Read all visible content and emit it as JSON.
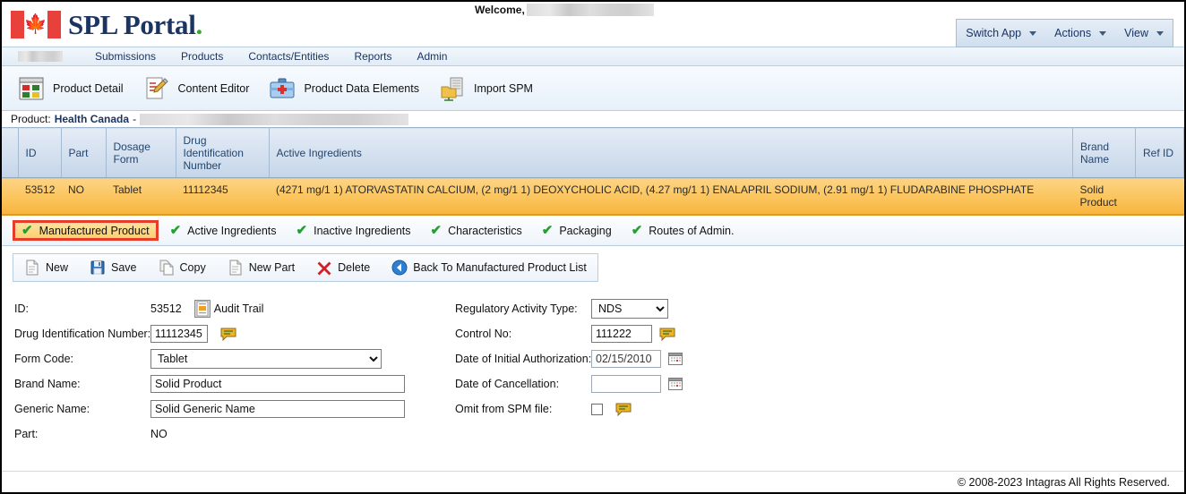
{
  "header": {
    "brand_name": "SPL Portal",
    "brand_dot": ".",
    "welcome_label": "Welcome,",
    "flag_icon": "canada-flag-icon"
  },
  "appbar": {
    "items": [
      {
        "label": "Switch App",
        "icon": "chevron-down-icon"
      },
      {
        "label": "Actions",
        "icon": "chevron-down-icon"
      },
      {
        "label": "View",
        "icon": "chevron-down-icon"
      }
    ]
  },
  "menu": {
    "items": [
      {
        "label": "Submissions"
      },
      {
        "label": "Products"
      },
      {
        "label": "Contacts/Entities"
      },
      {
        "label": "Reports"
      },
      {
        "label": "Admin"
      }
    ]
  },
  "icon_toolbar": {
    "items": [
      {
        "label": "Product Detail",
        "icon": "grid-window-icon"
      },
      {
        "label": "Content Editor",
        "icon": "pencil-document-icon"
      },
      {
        "label": "Product Data Elements",
        "icon": "medical-kit-icon"
      },
      {
        "label": "Import SPM",
        "icon": "server-folder-icon"
      }
    ]
  },
  "product_line": {
    "label": "Product:",
    "organization": "Health Canada",
    "separator": "-"
  },
  "grid": {
    "columns": [
      "ID",
      "Part",
      "Dosage Form",
      "Drug Identification Number",
      "Active Ingredients",
      "Brand Name",
      "Ref ID"
    ],
    "rows": [
      {
        "id": "53512",
        "part": "NO",
        "dosage_form": "Tablet",
        "din": "11112345",
        "active_ingredients": "(4271 mg/1 1) ATORVASTATIN CALCIUM, (2 mg/1 1) DEOXYCHOLIC ACID, (4.27 mg/1 1) ENALAPRIL SODIUM, (2.91 mg/1 1) FLUDARABINE PHOSPHATE",
        "brand_name": "Solid Product",
        "ref_id": ""
      }
    ]
  },
  "section_tabs": {
    "check_glyph": "✔",
    "items": [
      {
        "label": "Manufactured Product",
        "active": true
      },
      {
        "label": "Active Ingredients",
        "active": false
      },
      {
        "label": "Inactive Ingredients",
        "active": false
      },
      {
        "label": "Characteristics",
        "active": false
      },
      {
        "label": "Packaging",
        "active": false
      },
      {
        "label": "Routes of Admin.",
        "active": false
      }
    ]
  },
  "action_bar": {
    "items": [
      {
        "label": "New",
        "icon": "new-document-icon"
      },
      {
        "label": "Save",
        "icon": "floppy-disk-icon"
      },
      {
        "label": "Copy",
        "icon": "copy-pages-icon"
      },
      {
        "label": "New Part",
        "icon": "new-part-document-icon"
      },
      {
        "label": "Delete",
        "icon": "red-x-icon"
      },
      {
        "label": "Back To Manufactured Product List",
        "icon": "back-arrow-icon"
      }
    ]
  },
  "form": {
    "left": {
      "id_label": "ID:",
      "id_value": "53512",
      "audit_trail_label": "Audit Trail",
      "audit_trail_icon": "audit-trail-icon",
      "din_label": "Drug Identification Number:",
      "din_value": "11112345",
      "din_comment_icon": "comment-bubble-icon",
      "form_code_label": "Form Code:",
      "form_code_value": "Tablet",
      "form_code_options": [
        "Tablet"
      ],
      "brand_name_label": "Brand Name:",
      "brand_name_value": "Solid Product",
      "generic_name_label": "Generic Name:",
      "generic_name_value": "Solid Generic Name",
      "part_label": "Part:",
      "part_value": "NO"
    },
    "right": {
      "reg_activity_label": "Regulatory Activity Type:",
      "reg_activity_value": "NDS",
      "reg_activity_options": [
        "NDS"
      ],
      "control_no_label": "Control No:",
      "control_no_value": "111222",
      "control_no_comment_icon": "comment-bubble-icon",
      "date_initial_label": "Date of Initial Authorization:",
      "date_initial_value": "02/15/2010",
      "date_initial_picker_icon": "calendar-icon",
      "date_cancel_label": "Date of Cancellation:",
      "date_cancel_value": "",
      "date_cancel_picker_icon": "calendar-icon",
      "omit_label": "Omit from SPM file:",
      "omit_checked": false,
      "omit_comment_icon": "comment-bubble-icon"
    }
  },
  "footer": {
    "copyright": "© 2008-2023 Intagras All Rights Reserved."
  },
  "colors": {
    "brand_navy": "#1b3461",
    "brand_green": "#3fa535",
    "flag_red": "#e8413b",
    "row_highlight": "#fbc45c",
    "active_tab_border": "#e83c2a",
    "check_green": "#23a031",
    "header_blue": "#c5d6e9"
  }
}
